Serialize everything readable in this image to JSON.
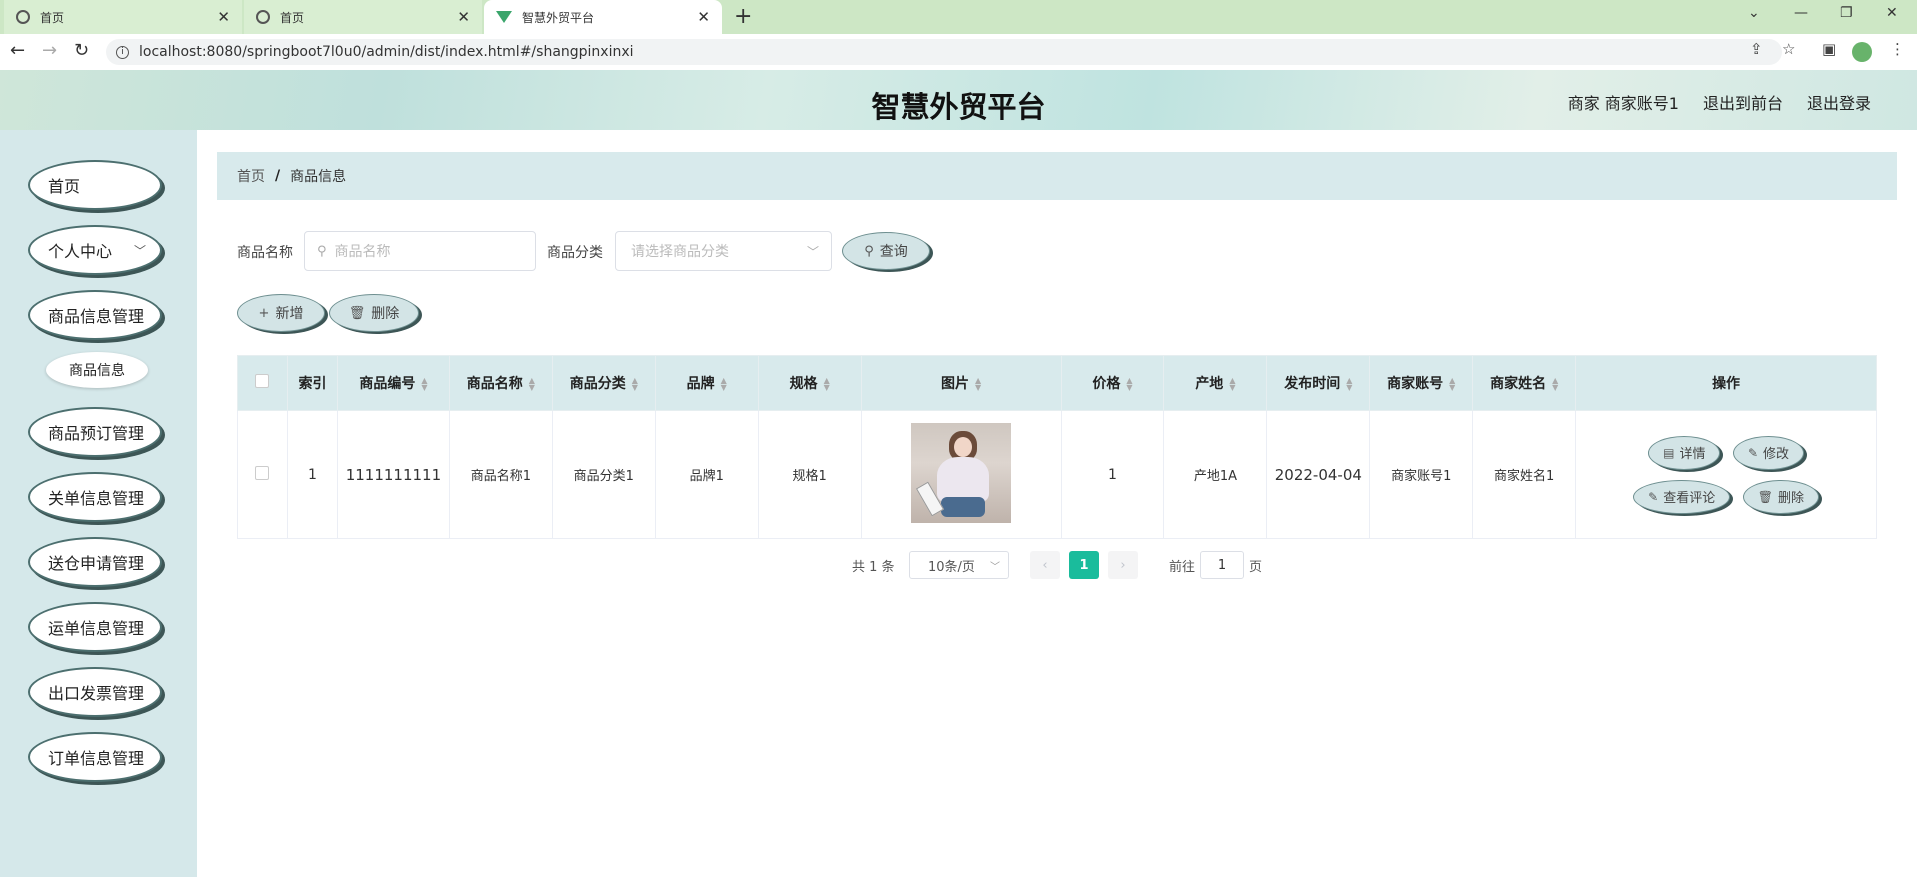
{
  "browser": {
    "tabs": [
      {
        "label": "首页"
      },
      {
        "label": "首页"
      },
      {
        "label": "智慧外贸平台"
      }
    ],
    "url": "localhost:8080/springboot7l0u0/admin/dist/index.html#/shangpinxinxi"
  },
  "header": {
    "title": "智慧外贸平台",
    "user": "商家 商家账号1",
    "to_front": "退出到前台",
    "logout": "退出登录"
  },
  "sidebar": {
    "items": [
      {
        "label": "首页"
      },
      {
        "label": "个人中心"
      },
      {
        "label": "商品信息管理"
      },
      {
        "label": "商品预订管理"
      },
      {
        "label": "关单信息管理"
      },
      {
        "label": "送仓申请管理"
      },
      {
        "label": "运单信息管理"
      },
      {
        "label": "出口发票管理"
      },
      {
        "label": "订单信息管理"
      }
    ],
    "subitem": "商品信息"
  },
  "breadcrumb": {
    "home": "首页",
    "current": "商品信息"
  },
  "search": {
    "name_label": "商品名称",
    "name_placeholder": "商品名称",
    "category_label": "商品分类",
    "category_placeholder": "请选择商品分类",
    "query_button": "查询"
  },
  "actions": {
    "add": "新增",
    "delete": "删除"
  },
  "table": {
    "headers": [
      "索引",
      "商品编号",
      "商品名称",
      "商品分类",
      "品牌",
      "规格",
      "图片",
      "价格",
      "产地",
      "发布时间",
      "商家账号",
      "商家姓名",
      "操作"
    ],
    "rows": [
      {
        "index": "1",
        "code": "1111111111",
        "name": "商品名称1",
        "category": "商品分类1",
        "brand": "品牌1",
        "spec": "规格1",
        "price": "1",
        "origin": "产地1A",
        "date": "2022-04-04",
        "account": "商家账号1",
        "merchant": "商家姓名1"
      }
    ],
    "ops": {
      "detail": "详情",
      "edit": "修改",
      "comments": "查看评论",
      "delete": "删除"
    }
  },
  "pagination": {
    "total": "共 1 条",
    "page_size": "10条/页",
    "current": "1",
    "goto_prefix": "前往",
    "goto_value": "1",
    "goto_suffix": "页"
  }
}
